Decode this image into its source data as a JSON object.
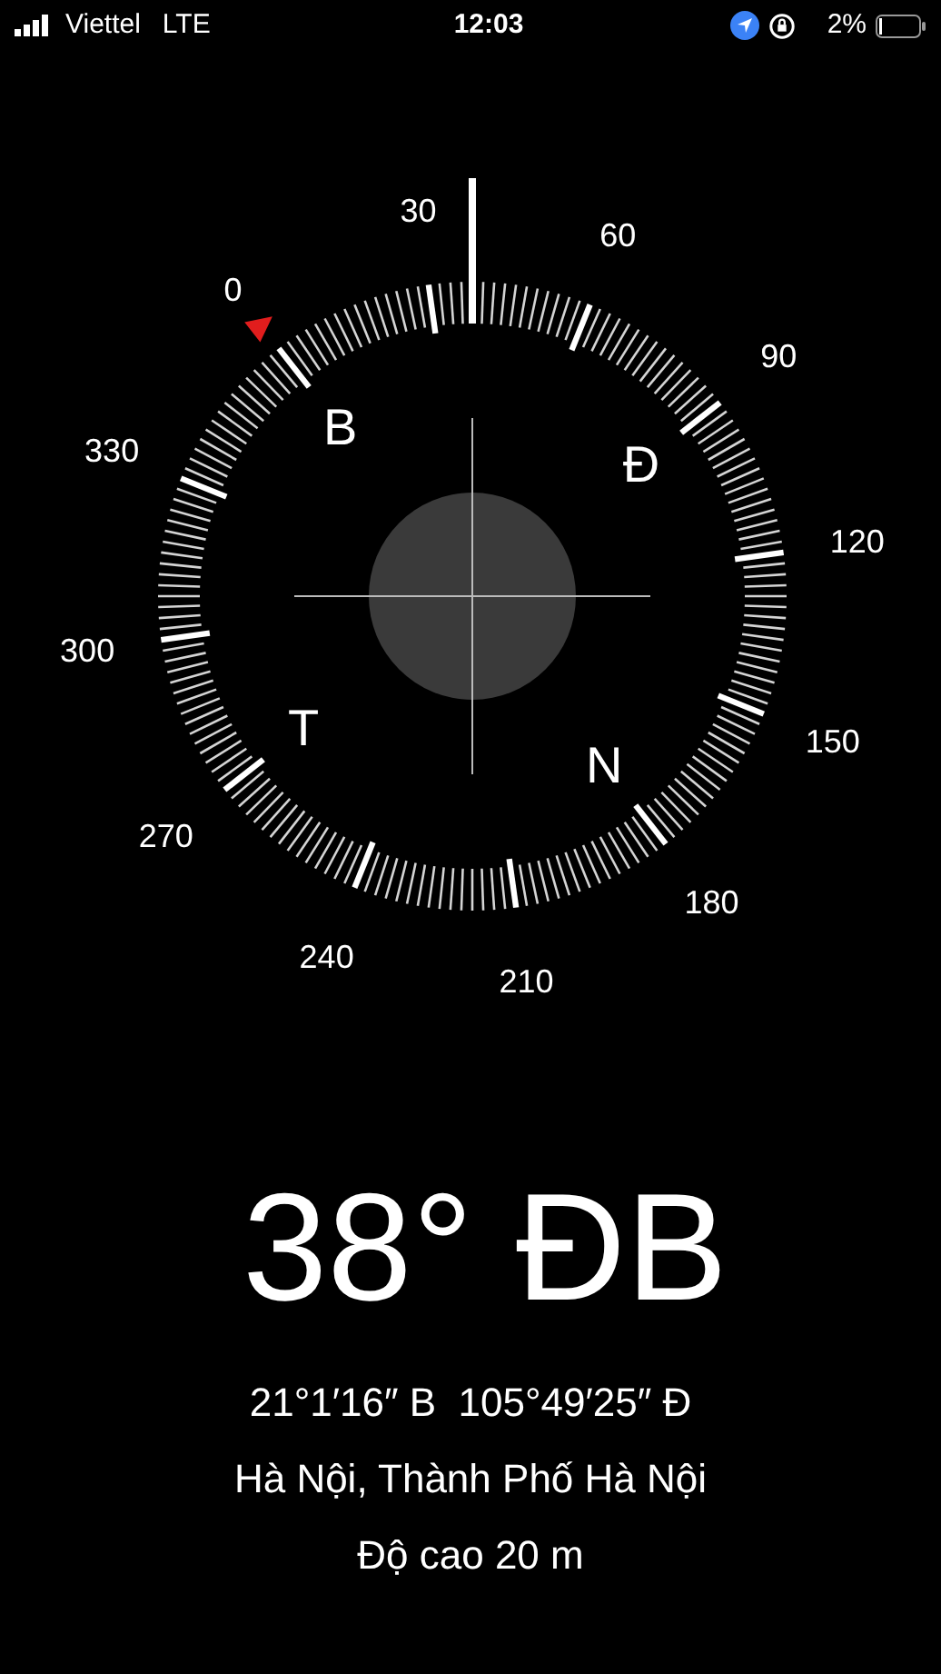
{
  "status_bar": {
    "carrier": "Viettel",
    "network": "LTE",
    "time": "12:03",
    "battery": "2%"
  },
  "compass": {
    "degree_labels": [
      "0",
      "30",
      "60",
      "90",
      "120",
      "150",
      "180",
      "210",
      "240",
      "270",
      "300",
      "330"
    ],
    "cardinals": [
      "B",
      "Đ",
      "N",
      "T"
    ]
  },
  "heading": "38° ĐB",
  "coordinates": "21°1′16″ B  105°49′25″ Đ",
  "location": "Hà Nội, Thành Phố Hà Nội",
  "altitude": "Độ cao 20 m"
}
